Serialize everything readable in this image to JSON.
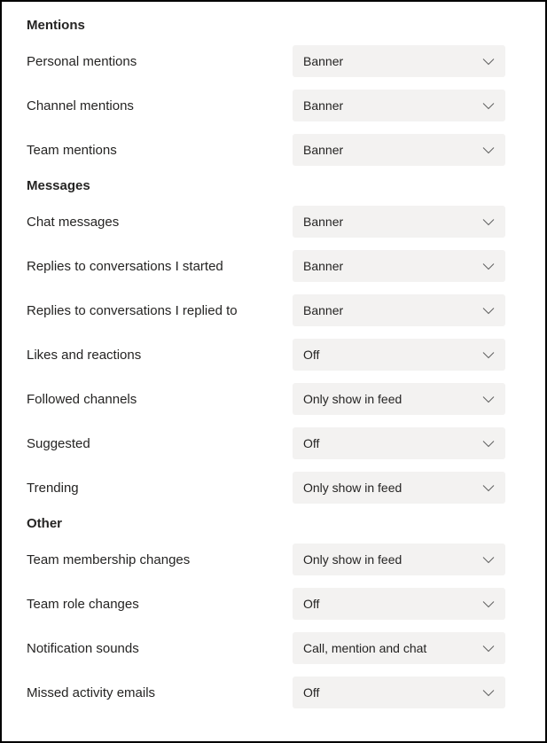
{
  "sections": [
    {
      "title": "Mentions",
      "name": "mentions",
      "rows": [
        {
          "name": "personal-mentions",
          "label": "Personal mentions",
          "value": "Banner"
        },
        {
          "name": "channel-mentions",
          "label": "Channel mentions",
          "value": "Banner"
        },
        {
          "name": "team-mentions",
          "label": "Team mentions",
          "value": "Banner"
        }
      ]
    },
    {
      "title": "Messages",
      "name": "messages",
      "rows": [
        {
          "name": "chat-messages",
          "label": "Chat messages",
          "value": "Banner"
        },
        {
          "name": "replies-started",
          "label": "Replies to conversations I started",
          "value": "Banner"
        },
        {
          "name": "replies-replied",
          "label": "Replies to conversations I replied to",
          "value": "Banner"
        },
        {
          "name": "likes-reactions",
          "label": "Likes and reactions",
          "value": "Off"
        },
        {
          "name": "followed-channels",
          "label": "Followed channels",
          "value": "Only show in feed"
        },
        {
          "name": "suggested",
          "label": "Suggested",
          "value": "Off"
        },
        {
          "name": "trending",
          "label": "Trending",
          "value": "Only show in feed"
        }
      ]
    },
    {
      "title": "Other",
      "name": "other",
      "rows": [
        {
          "name": "team-membership-changes",
          "label": "Team membership changes",
          "value": "Only show in feed"
        },
        {
          "name": "team-role-changes",
          "label": "Team role changes",
          "value": "Off"
        },
        {
          "name": "notification-sounds",
          "label": "Notification sounds",
          "value": "Call, mention and chat"
        },
        {
          "name": "missed-activity-emails",
          "label": "Missed activity emails",
          "value": "Off"
        }
      ]
    }
  ]
}
